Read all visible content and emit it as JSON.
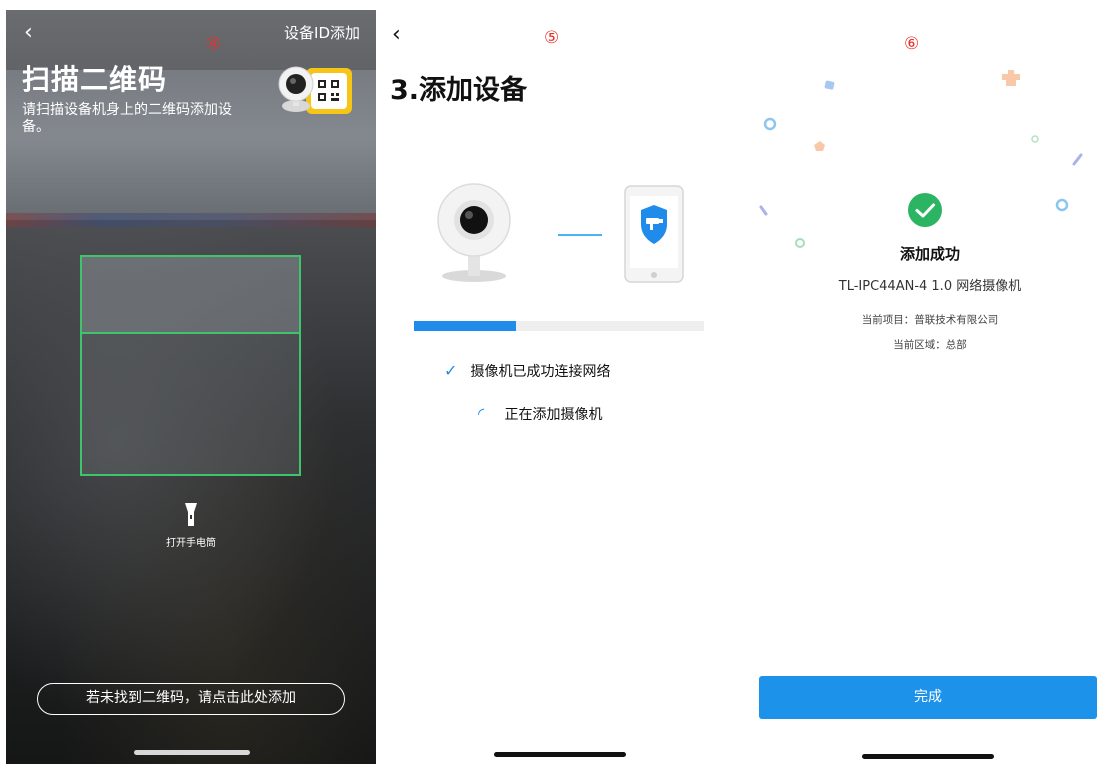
{
  "scan": {
    "marker": "④",
    "back": "‹",
    "device_id_add": "设备ID添加",
    "title": "扫描二维码",
    "subtitle": "请扫描设备机身上的二维码添加设备。",
    "flashlight": "打开手电筒",
    "manual_add": "若未找到二维码，请点击此处添加"
  },
  "adding": {
    "marker": "⑤",
    "back": "‹",
    "title": "3.添加设备",
    "progress": 0.35,
    "steps": [
      {
        "icon": "✓",
        "text": "摄像机已成功连接网络"
      },
      {
        "icon": "◜",
        "text": "正在添加摄像机"
      }
    ]
  },
  "success": {
    "marker": "⑥",
    "status": "添加成功",
    "model": "TL-IPC44AN-4 1.0 网络摄像机",
    "project": "当前项目：普联技术有限公司",
    "region": "当前区域：总部",
    "done": "完成"
  },
  "colors": {
    "accent_blue": "#1d92ea",
    "scan_green": "#3ec46d",
    "success_green": "#2bb562",
    "marker_red": "#e8312b"
  }
}
